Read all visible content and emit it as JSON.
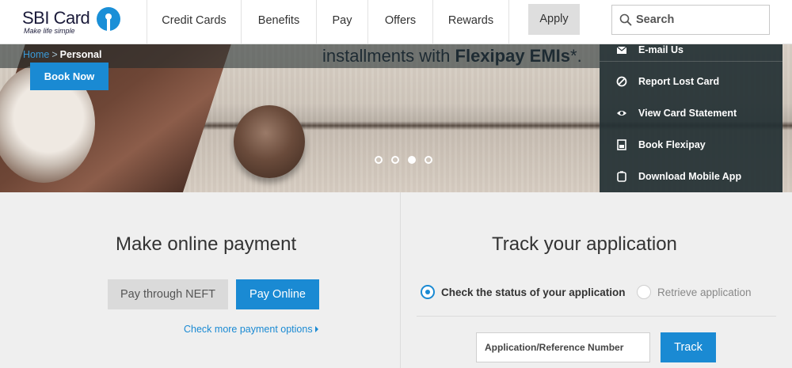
{
  "brand": {
    "name": "SBI Card",
    "tagline": "Make life simple"
  },
  "nav": {
    "items": [
      {
        "label": "Credit Cards",
        "icon": ""
      },
      {
        "label": "Benefits"
      },
      {
        "label": "Pay"
      },
      {
        "label": "Offers"
      },
      {
        "label": "Rewards"
      }
    ],
    "apply_label": "Apply"
  },
  "search": {
    "placeholder": "Search",
    "icon": "search-icon"
  },
  "banner": {
    "headline_prefix": "installments with ",
    "headline_bold": "Flexipay EMIs",
    "headline_suffix": "*.",
    "book_now_label": "Book Now",
    "slides": [
      {
        "active": false
      },
      {
        "active": false
      },
      {
        "active": true
      },
      {
        "active": false
      }
    ]
  },
  "breadcrumb": {
    "home": "Home",
    "separator": ">",
    "current": "Personal"
  },
  "quick_menu": {
    "items": [
      {
        "label": "E-mail Us",
        "icon": "email-icon"
      },
      {
        "label": "Report Lost Card",
        "icon": "block-icon"
      },
      {
        "label": "View Card Statement",
        "icon": "eye-icon"
      },
      {
        "label": "Book Flexipay",
        "icon": "document-icon"
      },
      {
        "label": "Download Mobile App",
        "icon": "mobile-icon"
      }
    ]
  },
  "payment": {
    "title": "Make online payment",
    "neft_label": "Pay through NEFT",
    "online_label": "Pay Online",
    "more_link": "Check more payment options"
  },
  "track": {
    "title": "Track your application",
    "option_status": "Check the status of your application",
    "option_retrieve": "Retrieve application",
    "input_placeholder": "Application/Reference Number",
    "track_label": "Track"
  },
  "colors": {
    "accent": "#1a8ad3",
    "dark_panel": "#243034",
    "page_bg": "#efefef"
  }
}
